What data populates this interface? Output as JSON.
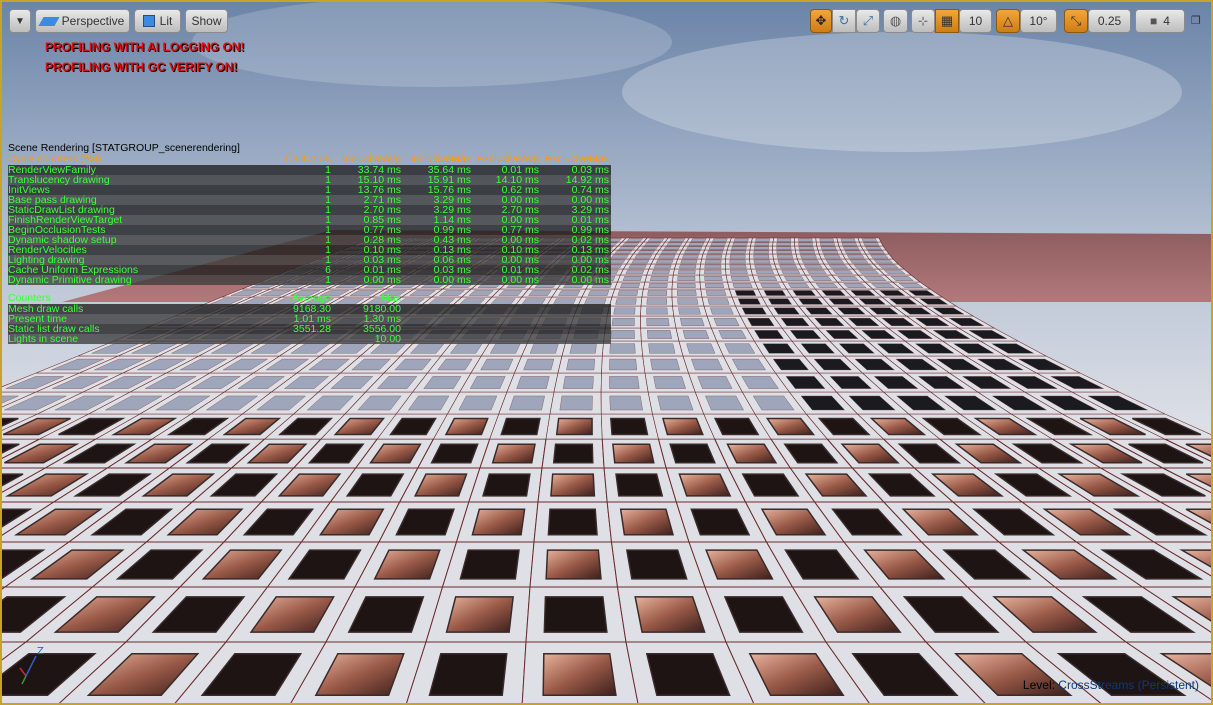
{
  "toolbar": {
    "perspective_label": "Perspective",
    "lit_label": "Lit",
    "show_label": "Show",
    "grid_snap_value": "10",
    "rotation_snap_value": "10°",
    "scale_snap_value": "0.25",
    "camera_speed_value": "4"
  },
  "messages": {
    "ai_logging": "PROFILING WITH AI LOGGING ON!",
    "gc_verify": "PROFILING WITH GC VERIFY ON!"
  },
  "stats": {
    "title": "Scene Rendering [STATGROUP_scenerendering]",
    "cycle_header": [
      "Cycle counters (flat)",
      "CallCount",
      "InclusiveAvg",
      "InclusiveMax",
      "ExclusiveAvg",
      "ExclusiveMax"
    ],
    "cycle_rows": [
      {
        "name": "RenderViewFamily",
        "count": "1",
        "incl_avg": "33.74 ms",
        "incl_max": "35.64 ms",
        "excl_avg": "0.01 ms",
        "excl_max": "0.03 ms",
        "bar": 1.0
      },
      {
        "name": "Translucency drawing",
        "count": "1",
        "incl_avg": "15.10 ms",
        "incl_max": "15.91 ms",
        "excl_avg": "14.10 ms",
        "excl_max": "14.92 ms",
        "bar": 0.45
      },
      {
        "name": "InitViews",
        "count": "1",
        "incl_avg": "13.76 ms",
        "incl_max": "15.76 ms",
        "excl_avg": "0.62 ms",
        "excl_max": "0.74 ms",
        "bar": 0.41
      },
      {
        "name": "Base pass drawing",
        "count": "1",
        "incl_avg": "2.71 ms",
        "incl_max": "3.29 ms",
        "excl_avg": "0.00 ms",
        "excl_max": "0.00 ms",
        "bar": 0.08
      },
      {
        "name": "StaticDrawList drawing",
        "count": "1",
        "incl_avg": "2.70 ms",
        "incl_max": "3.29 ms",
        "excl_avg": "2.70 ms",
        "excl_max": "3.29 ms",
        "bar": 0.08
      },
      {
        "name": "FinishRenderViewTarget",
        "count": "1",
        "incl_avg": "0.85 ms",
        "incl_max": "1.14 ms",
        "excl_avg": "0.00 ms",
        "excl_max": "0.01 ms",
        "bar": 0.03
      },
      {
        "name": "BeginOcclusionTests",
        "count": "1",
        "incl_avg": "0.77 ms",
        "incl_max": "0.99 ms",
        "excl_avg": "0.77 ms",
        "excl_max": "0.99 ms",
        "bar": 0.02
      },
      {
        "name": "Dynamic shadow setup",
        "count": "1",
        "incl_avg": "0.28 ms",
        "incl_max": "0.43 ms",
        "excl_avg": "0.00 ms",
        "excl_max": "0.02 ms",
        "bar": 0
      },
      {
        "name": "RenderVelocities",
        "count": "1",
        "incl_avg": "0.10 ms",
        "incl_max": "0.13 ms",
        "excl_avg": "0.10 ms",
        "excl_max": "0.13 ms",
        "bar": 0
      },
      {
        "name": "Lighting drawing",
        "count": "1",
        "incl_avg": "0.03 ms",
        "incl_max": "0.06 ms",
        "excl_avg": "0.00 ms",
        "excl_max": "0.00 ms",
        "bar": 0
      },
      {
        "name": "Cache Uniform Expressions",
        "count": "6",
        "incl_avg": "0.01 ms",
        "incl_max": "0.03 ms",
        "excl_avg": "0.01 ms",
        "excl_max": "0.02 ms",
        "bar": 0
      },
      {
        "name": "Dynamic Primitive drawing",
        "count": "1",
        "incl_avg": "0.00 ms",
        "incl_max": "0.00 ms",
        "excl_avg": "0.00 ms",
        "excl_max": "0.00 ms",
        "bar": 0
      }
    ],
    "counter_header": [
      "Counters",
      "Average",
      "Max"
    ],
    "counter_rows": [
      {
        "name": "Mesh draw calls",
        "avg": "9168.30",
        "max": "9180.00",
        "bar": 0
      },
      {
        "name": "Present time",
        "avg": "1.01 ms",
        "max": "1.30 ms",
        "bar": 0.03
      },
      {
        "name": "Static list draw calls",
        "avg": "3551.28",
        "max": "3556.00",
        "bar": 0
      },
      {
        "name": "Lights in scene",
        "avg": "",
        "max": "10.00",
        "bar": 0
      }
    ]
  },
  "level": {
    "prefix": "Level:",
    "name": "CrossStreams (Persistent)"
  },
  "axis": {
    "z": "Z"
  },
  "colors": {
    "accent": "#f2a63a",
    "stat_text": "#3cff3c",
    "stat_header": "#ff9900",
    "warning": "#e10d0d"
  }
}
